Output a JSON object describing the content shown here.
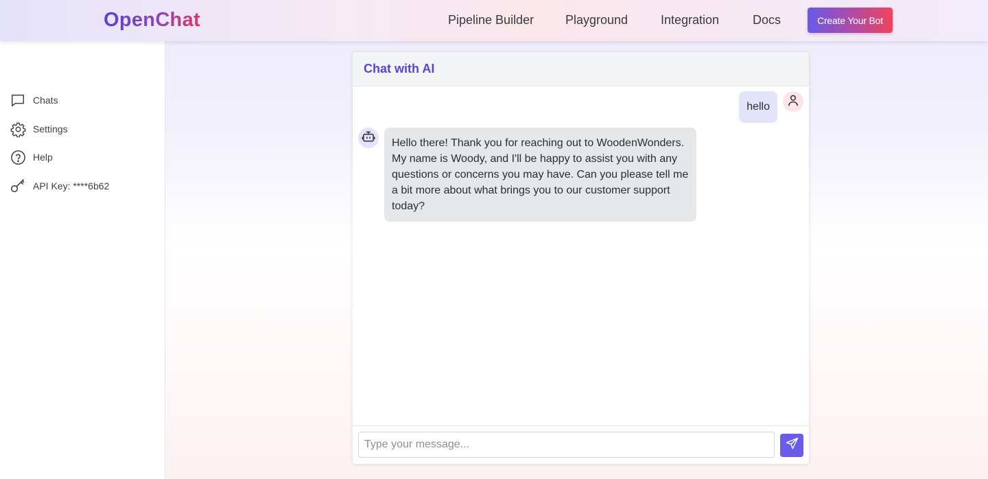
{
  "app": {
    "logo": "OpenChat"
  },
  "nav": {
    "links": [
      "Pipeline Builder",
      "Playground",
      "Integration",
      "Docs"
    ],
    "cta_label": "Create Your Bot",
    "cta_colors": [
      "#6a5ae8",
      "#f0445c"
    ]
  },
  "sidebar": {
    "items": [
      {
        "label": "Chats",
        "icon": "chat-bubble-icon"
      },
      {
        "label": "Settings",
        "icon": "gear-icon"
      },
      {
        "label": "Help",
        "icon": "question-circle-icon"
      },
      {
        "label": "API Key: ****6b62",
        "icon": "key-icon"
      }
    ]
  },
  "chat": {
    "title": "Chat with AI",
    "messages": [
      {
        "role": "user",
        "text": "hello",
        "avatar_icon": "user-icon"
      },
      {
        "role": "bot",
        "text": "Hello there! Thank you for reaching out to WoodenWonders. My name is Woody, and I'll be happy to assist you with any questions or concerns you may have. Can you please tell me a bit more about what brings you to our customer support today?",
        "avatar_icon": "robot-icon"
      }
    ],
    "input": {
      "value": "",
      "placeholder": "Type your message..."
    },
    "send_icon": "send-icon"
  },
  "colors": {
    "accent": "#5a43d6",
    "send_button": "#6b5de8",
    "user_bubble": "#e3e4fb",
    "bot_bubble": "#e6e7eb"
  }
}
